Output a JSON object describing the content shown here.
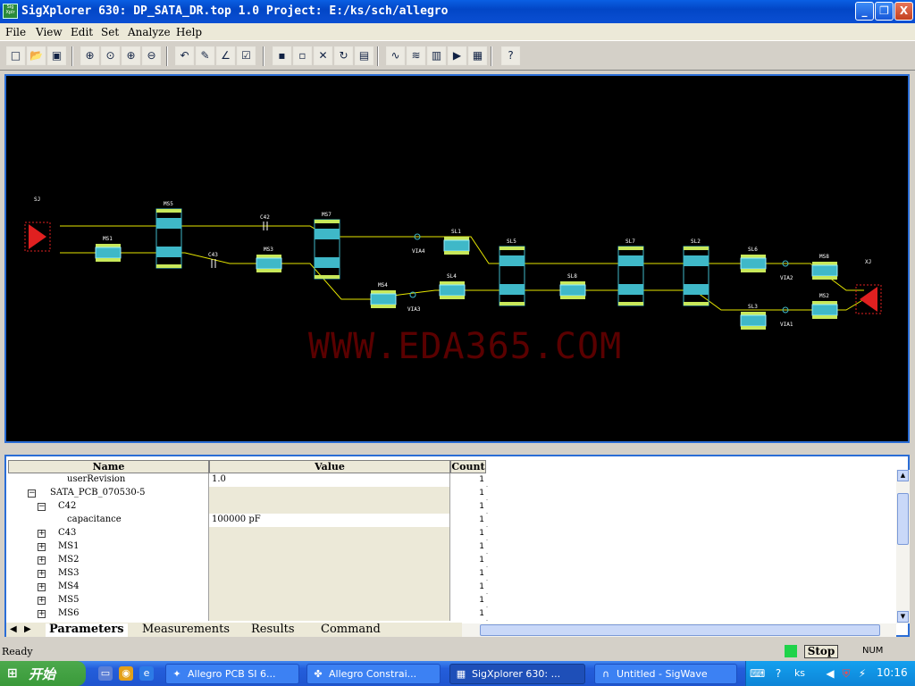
{
  "window": {
    "title": "SigXplorer 630: DP_SATA_DR.top 1.0   Project: E:/ks/sch/allegro",
    "app_icon": "sigxplorer-icon",
    "controls": [
      "_",
      "❐",
      "X"
    ]
  },
  "menu": [
    "File",
    "View",
    "Edit",
    "Set",
    "Analyze",
    "Help"
  ],
  "toolbar": {
    "buttons": [
      {
        "name": "new-icon",
        "glyph": "□"
      },
      {
        "name": "open-icon",
        "glyph": "📂"
      },
      {
        "name": "save-icon",
        "glyph": "▣"
      },
      {
        "name": "zoom-fit-icon",
        "glyph": "⊕"
      },
      {
        "name": "zoom-window-icon",
        "glyph": "⊙"
      },
      {
        "name": "zoom-in-icon",
        "glyph": "⊕"
      },
      {
        "name": "zoom-out-icon",
        "glyph": "⊖"
      },
      {
        "name": "undo-icon",
        "glyph": "↶"
      },
      {
        "name": "probe-icon",
        "glyph": "✎"
      },
      {
        "name": "signal-icon",
        "glyph": "∠"
      },
      {
        "name": "checklist-icon",
        "glyph": "☑"
      },
      {
        "name": "add-element-icon",
        "glyph": "▪"
      },
      {
        "name": "add-part-icon",
        "glyph": "▫"
      },
      {
        "name": "delete-icon",
        "glyph": "✕"
      },
      {
        "name": "rotate-icon",
        "glyph": "↻"
      },
      {
        "name": "group-icon",
        "glyph": "▤"
      },
      {
        "name": "waveform-icon",
        "glyph": "∿"
      },
      {
        "name": "sweep-icon",
        "glyph": "≋"
      },
      {
        "name": "histogram-icon",
        "glyph": "▥"
      },
      {
        "name": "analyze-icon",
        "glyph": "▶"
      },
      {
        "name": "report-icon",
        "glyph": "▦"
      },
      {
        "name": "help-icon",
        "glyph": "?"
      }
    ]
  },
  "canvas": {
    "watermark": "WWW.EDA365.COM",
    "components": [
      "SJ",
      "MS1",
      "MS5",
      "C42",
      "C43",
      "MS3",
      "MS7",
      "MS4",
      "VIA4",
      "VIA3",
      "SL1",
      "SL4",
      "SL5",
      "SL8",
      "SL7",
      "SL2",
      "SL6",
      "SL3",
      "VIA2",
      "VIA1",
      "MS8",
      "MS2",
      "XJ"
    ]
  },
  "parameters": {
    "columns": [
      "Name",
      "Value",
      "Count"
    ],
    "rows": [
      {
        "name": "userRevision",
        "value": "1.0",
        "count": "1",
        "level": 2,
        "expander": "",
        "editable": true
      },
      {
        "name": "SATA_PCB_070530-5",
        "value": "",
        "count": "1",
        "level": 1,
        "expander": "−",
        "editable": false
      },
      {
        "name": "C42",
        "value": "",
        "count": "1",
        "level": 2,
        "expander": "−",
        "editable": false
      },
      {
        "name": "capacitance",
        "value": "100000 pF",
        "count": "1",
        "level": 3,
        "expander": "",
        "editable": true
      },
      {
        "name": "C43",
        "value": "",
        "count": "1",
        "level": 2,
        "expander": "+",
        "editable": false
      },
      {
        "name": "MS1",
        "value": "",
        "count": "1",
        "level": 2,
        "expander": "+",
        "editable": false
      },
      {
        "name": "MS2",
        "value": "",
        "count": "1",
        "level": 2,
        "expander": "+",
        "editable": false
      },
      {
        "name": "MS3",
        "value": "",
        "count": "1",
        "level": 2,
        "expander": "+",
        "editable": false
      },
      {
        "name": "MS4",
        "value": "",
        "count": "1",
        "level": 2,
        "expander": "+",
        "editable": false
      },
      {
        "name": "MS5",
        "value": "",
        "count": "1",
        "level": 2,
        "expander": "+",
        "editable": false
      },
      {
        "name": "MS6",
        "value": "",
        "count": "1",
        "level": 2,
        "expander": "+",
        "editable": false
      }
    ]
  },
  "tabs": [
    "Parameters",
    "Measurements",
    "Results",
    "Command"
  ],
  "active_tab": "Parameters",
  "status": {
    "text": "Ready",
    "stop_label": "Stop",
    "num": "NUM"
  },
  "taskbar": {
    "start_label": "开始",
    "tasks": [
      {
        "label": "Allegro PCB SI 6...",
        "icon": "allegro-icon",
        "active": false
      },
      {
        "label": "Allegro Constrai...",
        "icon": "constraint-icon",
        "active": false
      },
      {
        "label": "SigXplorer 630: ...",
        "icon": "sigxplorer-icon",
        "active": true
      },
      {
        "label": "Untitled - SigWave",
        "icon": "sigwave-icon",
        "active": false
      }
    ],
    "tray_user": "ks",
    "clock": "10:16"
  },
  "colors": {
    "title_bar": "#0a5fe3",
    "canvas_bg": "#000000",
    "wire": "#e6e600",
    "component": "#3fb8c8",
    "driver": "#e02020",
    "watermark": "#5a0000"
  }
}
